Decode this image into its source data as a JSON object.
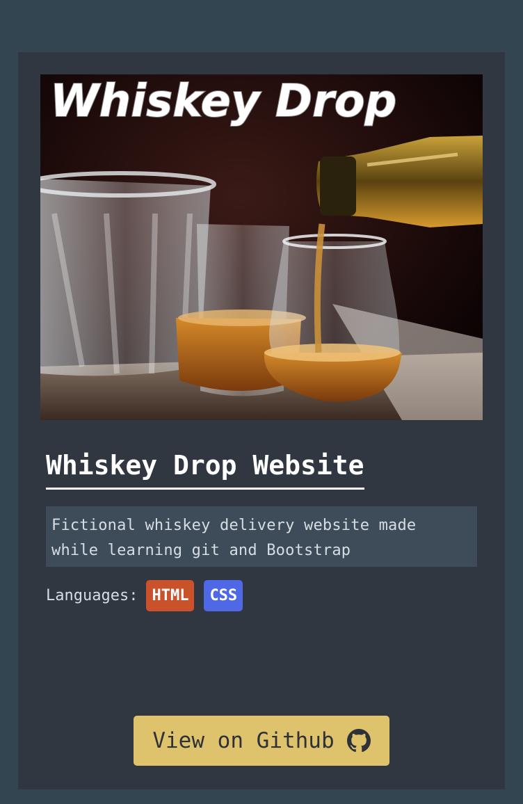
{
  "project": {
    "image_logo_text": "Whiskey Drop",
    "title": "Whiskey Drop Website",
    "description_line1": "Fictional whiskey delivery website made",
    "description_line2": "while learning git and Bootstrap",
    "languages_label": "Languages:",
    "languages": [
      {
        "name": "HTML",
        "color": "#c9522a"
      },
      {
        "name": "CSS",
        "color": "#4f68e6"
      }
    ],
    "github_button_label": "View on Github",
    "github_icon": "github-icon"
  },
  "colors": {
    "page_background": "#344552",
    "card_background": "#313740",
    "button_accent": "#dec26c",
    "description_background": "#3e4c5a"
  }
}
